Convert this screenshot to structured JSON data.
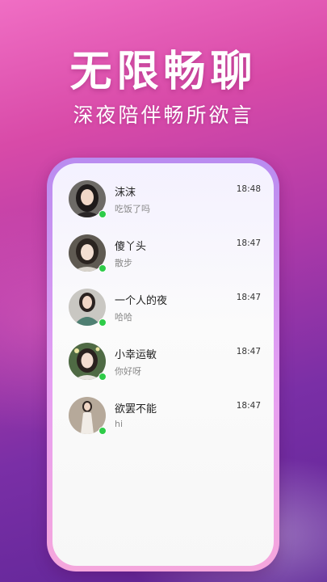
{
  "hero": {
    "title": "无限畅聊",
    "subtitle": "深夜陪伴畅所欲言"
  },
  "chats": [
    {
      "name": "沫沫",
      "message": "吃饭了吗",
      "time": "18:48",
      "online": true
    },
    {
      "name": "傻丫头",
      "message": "散步",
      "time": "18:47",
      "online": true
    },
    {
      "name": "一个人的夜",
      "message": "哈哈",
      "time": "18:47",
      "online": true
    },
    {
      "name": "小幸运敏",
      "message": "你好呀",
      "time": "18:47",
      "online": true
    },
    {
      "name": "欲罢不能",
      "message": "hi",
      "time": "18:47",
      "online": true
    }
  ],
  "colors": {
    "online": "#2ecc48",
    "background_top": "#f06ec4",
    "background_bottom": "#5d2596"
  }
}
